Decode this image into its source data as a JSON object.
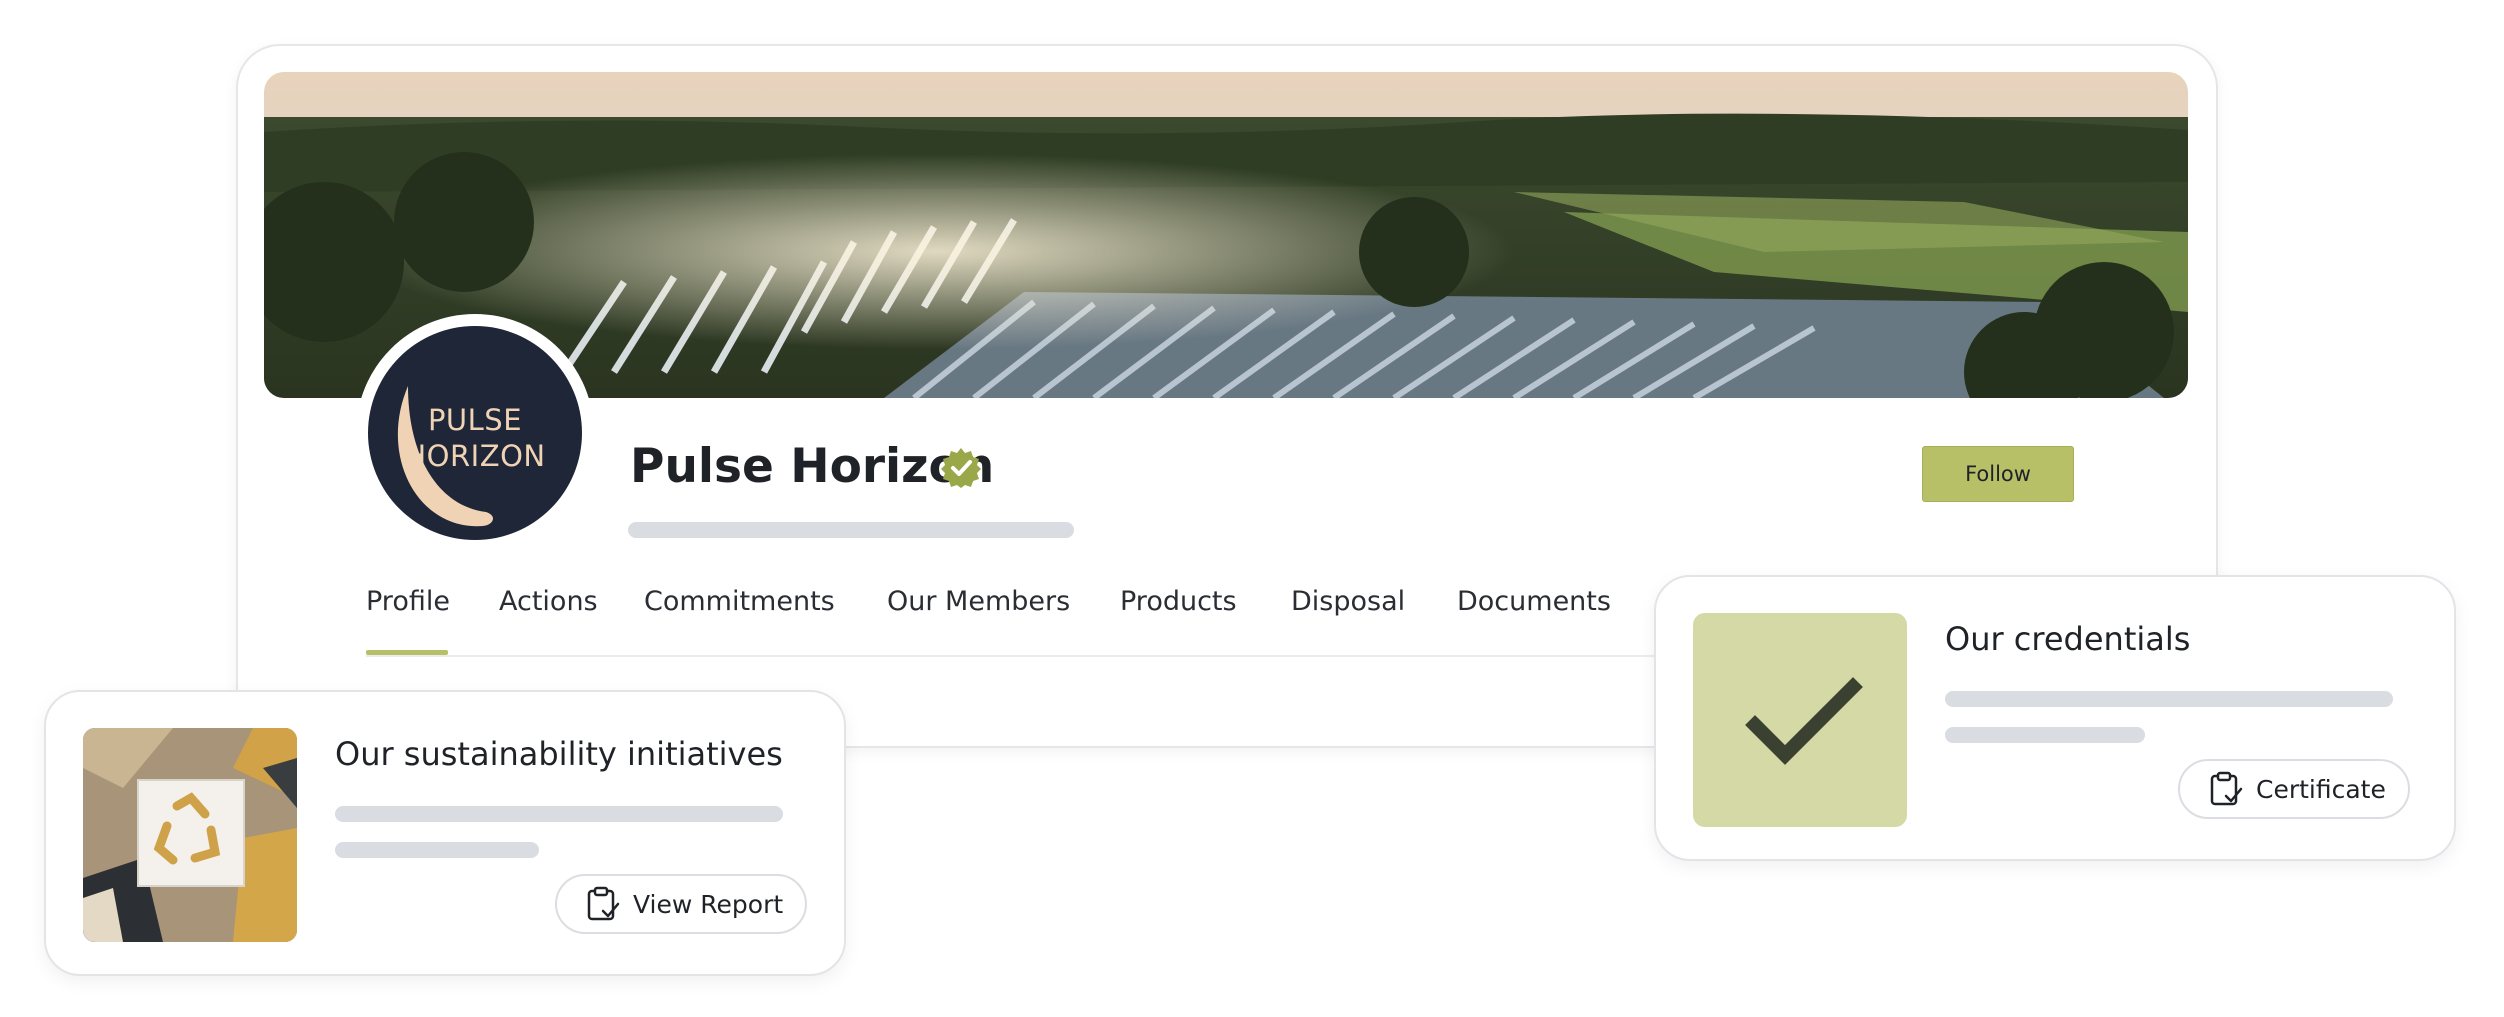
{
  "profile": {
    "logo_lines": [
      "PULSE",
      "HORIZON"
    ],
    "name": "Pulse Horizon",
    "verified": true,
    "follow_label": "Follow",
    "banner_image": "aerial view of solar farm among trees at sunset"
  },
  "tabs": [
    {
      "label": "Profile",
      "active": true
    },
    {
      "label": "Actions",
      "active": false
    },
    {
      "label": "Commitments",
      "active": false
    },
    {
      "label": "Our Members",
      "active": false
    },
    {
      "label": "Products",
      "active": false
    },
    {
      "label": "Disposal",
      "active": false
    },
    {
      "label": "Documents",
      "active": false
    }
  ],
  "sustainability_card": {
    "title": "Our sustainability initiatives",
    "button_label": "View Report",
    "button_icon": "clipboard-check-icon",
    "thumbnail": "recycling box among packaging"
  },
  "credentials_card": {
    "title": "Our credentials",
    "button_label": "Certificate",
    "button_icon": "clipboard-check-icon",
    "tile_icon": "checkmark-icon"
  },
  "colors": {
    "accent": "#b7bf67",
    "logo_bg": "#1e2638",
    "logo_text": "#efd3b4",
    "tile_bg": "#d5d9a6",
    "skeleton": "#d9dce1",
    "verified": "#9aa84a"
  }
}
